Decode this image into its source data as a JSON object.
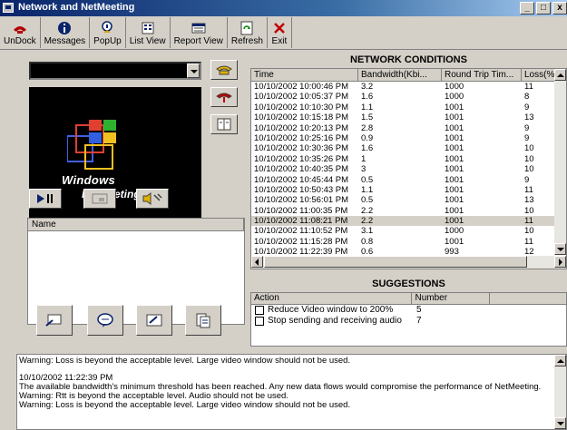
{
  "window": {
    "title": "Network and NetMeeting",
    "min": "_",
    "max": "□",
    "close": "x"
  },
  "toolbar": {
    "items": [
      {
        "label": "UnDock",
        "icon": "undock-icon"
      },
      {
        "label": "Messages",
        "icon": "info-icon"
      },
      {
        "label": "PopUp",
        "icon": "popup-icon"
      },
      {
        "label": "List View",
        "icon": "list-view-icon"
      },
      {
        "label": "Report View",
        "icon": "report-view-icon"
      },
      {
        "label": "Refresh",
        "icon": "refresh-icon"
      },
      {
        "label": "Exit",
        "icon": "exit-icon"
      }
    ]
  },
  "video": {
    "brand_line1": "Windows",
    "brand_line2": "NetMeeting"
  },
  "participants": {
    "header": "Name"
  },
  "network": {
    "title": "NETWORK CONDITIONS",
    "columns": [
      "Time",
      "Bandwidth(Kbi...",
      "Round Trip Tim...",
      "Loss(%"
    ],
    "rows": [
      [
        "10/10/2002 10:00:46 PM",
        "3.2",
        "1000",
        "11"
      ],
      [
        "10/10/2002 10:05:37 PM",
        "1.6",
        "1000",
        "8"
      ],
      [
        "10/10/2002 10:10:30 PM",
        "1.1",
        "1001",
        "9"
      ],
      [
        "10/10/2002 10:15:18 PM",
        "1.5",
        "1001",
        "13"
      ],
      [
        "10/10/2002 10:20:13 PM",
        "2.8",
        "1001",
        "9"
      ],
      [
        "10/10/2002 10:25:16 PM",
        "0.9",
        "1001",
        "9"
      ],
      [
        "10/10/2002 10:30:36 PM",
        "1.6",
        "1001",
        "10"
      ],
      [
        "10/10/2002 10:35:26 PM",
        "1",
        "1001",
        "10"
      ],
      [
        "10/10/2002 10:40:35 PM",
        "3",
        "1001",
        "10"
      ],
      [
        "10/10/2002 10:45:44 PM",
        "0.5",
        "1001",
        "9"
      ],
      [
        "10/10/2002 10:50:43 PM",
        "1.1",
        "1001",
        "11"
      ],
      [
        "10/10/2002 10:56:01 PM",
        "0.5",
        "1001",
        "13"
      ],
      [
        "10/10/2002 11:00:35 PM",
        "2.2",
        "1001",
        "10"
      ],
      [
        "10/10/2002 11:08:21 PM",
        "2.2",
        "1001",
        "11"
      ],
      [
        "10/10/2002 11:10:52 PM",
        "3.1",
        "1000",
        "10"
      ],
      [
        "10/10/2002 11:15:28 PM",
        "0.8",
        "1001",
        "11"
      ],
      [
        "10/10/2002 11:22:39 PM",
        "0.6",
        "993",
        "12"
      ]
    ],
    "selected_row": 13
  },
  "suggestions": {
    "title": "SUGGESTIONS",
    "columns": [
      "Action",
      "Number"
    ],
    "rows": [
      {
        "action": "Reduce Video window to 200%",
        "number": "5"
      },
      {
        "action": "Stop sending and receiving audio",
        "number": "7"
      }
    ]
  },
  "log": {
    "lines": [
      "Warning: Loss is beyond the acceptable level. Large video window should not be used.",
      "",
      "10/10/2002 11:22:39 PM",
      "The available bandwidth's minimum threshold has been reached. Any new data flows would compromise the performance of NetMeeting.",
      "Warning: Rtt is beyond the acceptable level. Audio should not be used.",
      "Warning: Loss is beyond the acceptable level. Large video window should not be used."
    ]
  },
  "colors": {
    "titlebar": "#0a246a",
    "face": "#d4d0c8",
    "selected": "#d4d0c8"
  }
}
